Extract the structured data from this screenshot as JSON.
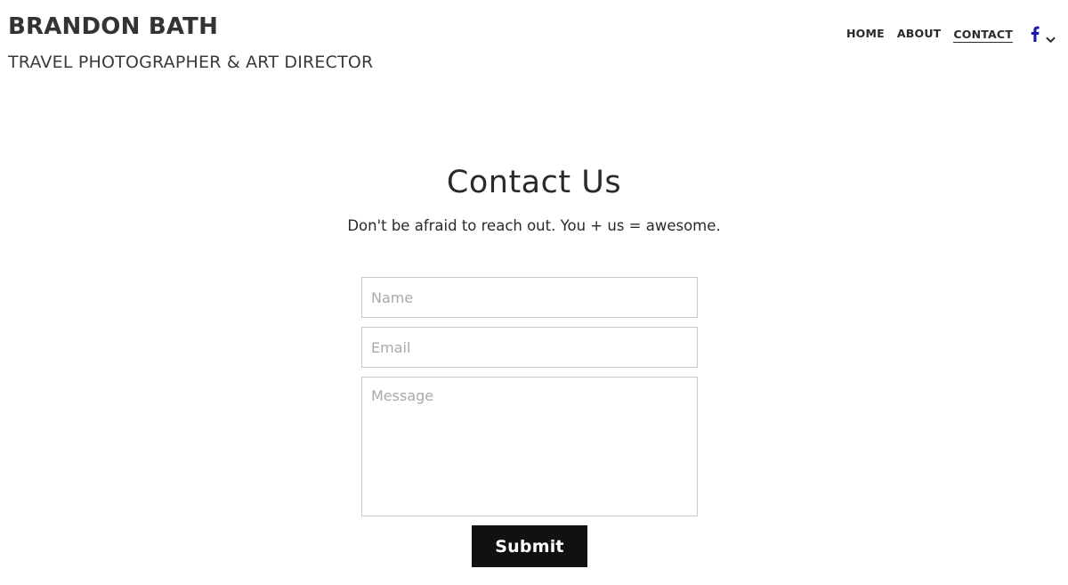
{
  "brand": {
    "name": "BRANDON BATH",
    "tagline": "TRAVEL PHOTOGRAPHER & ART DIRECTOR"
  },
  "nav": {
    "items": [
      {
        "label": "HOME",
        "active": false
      },
      {
        "label": "ABOUT",
        "active": false
      },
      {
        "label": "CONTACT",
        "active": true
      }
    ],
    "social_icon": "facebook-icon",
    "dropdown_icon": "chevron-down-icon",
    "facebook_color": "#1a1aa6"
  },
  "contact": {
    "title": "Contact Us",
    "subtitle": "Don't be afraid to reach out. You + us = awesome."
  },
  "form": {
    "name_placeholder": "Name",
    "email_placeholder": "Email",
    "message_placeholder": "Message",
    "name_value": "",
    "email_value": "",
    "message_value": "",
    "submit_label": "Submit"
  },
  "colors": {
    "button_bg": "#111111",
    "button_text": "#ffffff",
    "field_border": "#c9c9c9",
    "placeholder": "#a9a9a9"
  }
}
